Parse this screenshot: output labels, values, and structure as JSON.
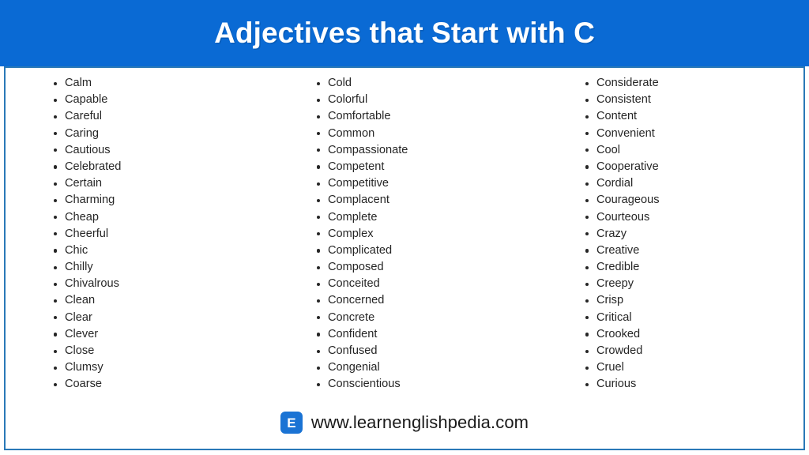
{
  "header": {
    "title": "Adjectives that Start with C",
    "background_color": "#0a6ad4",
    "text_color": "#ffffff"
  },
  "card": {
    "border_color": "#2a79b8",
    "background_color": "#ffffff"
  },
  "columns": [
    {
      "name": "column-1",
      "items": [
        "Calm",
        "Capable",
        "Careful",
        "Caring",
        "Cautious",
        "Celebrated",
        "Certain",
        "Charming",
        "Cheap",
        "Cheerful",
        "Chic",
        "Chilly",
        "Chivalrous",
        "Clean",
        "Clear",
        "Clever",
        "Close",
        "Clumsy",
        "Coarse"
      ]
    },
    {
      "name": "column-2",
      "items": [
        "Cold",
        "Colorful",
        "Comfortable",
        "Common",
        "Compassionate",
        "Competent",
        "Competitive",
        "Complacent",
        "Complete",
        "Complex",
        "Complicated",
        "Composed",
        "Conceited",
        "Concerned",
        "Concrete",
        "Confident",
        "Confused",
        "Congenial",
        "Conscientious"
      ]
    },
    {
      "name": "column-3",
      "items": [
        "Considerate",
        "Consistent",
        "Content",
        "Convenient",
        "Cool",
        "Cooperative",
        "Cordial",
        "Courageous",
        "Courteous",
        "Crazy",
        "Creative",
        "Credible",
        "Creepy",
        "Crisp",
        "Critical",
        "Crooked",
        "Crowded",
        "Cruel",
        "Curious"
      ]
    }
  ],
  "footer": {
    "logo_letter": "E",
    "logo_color": "#1a73d4",
    "url": "www.learnenglishpedia.com"
  }
}
